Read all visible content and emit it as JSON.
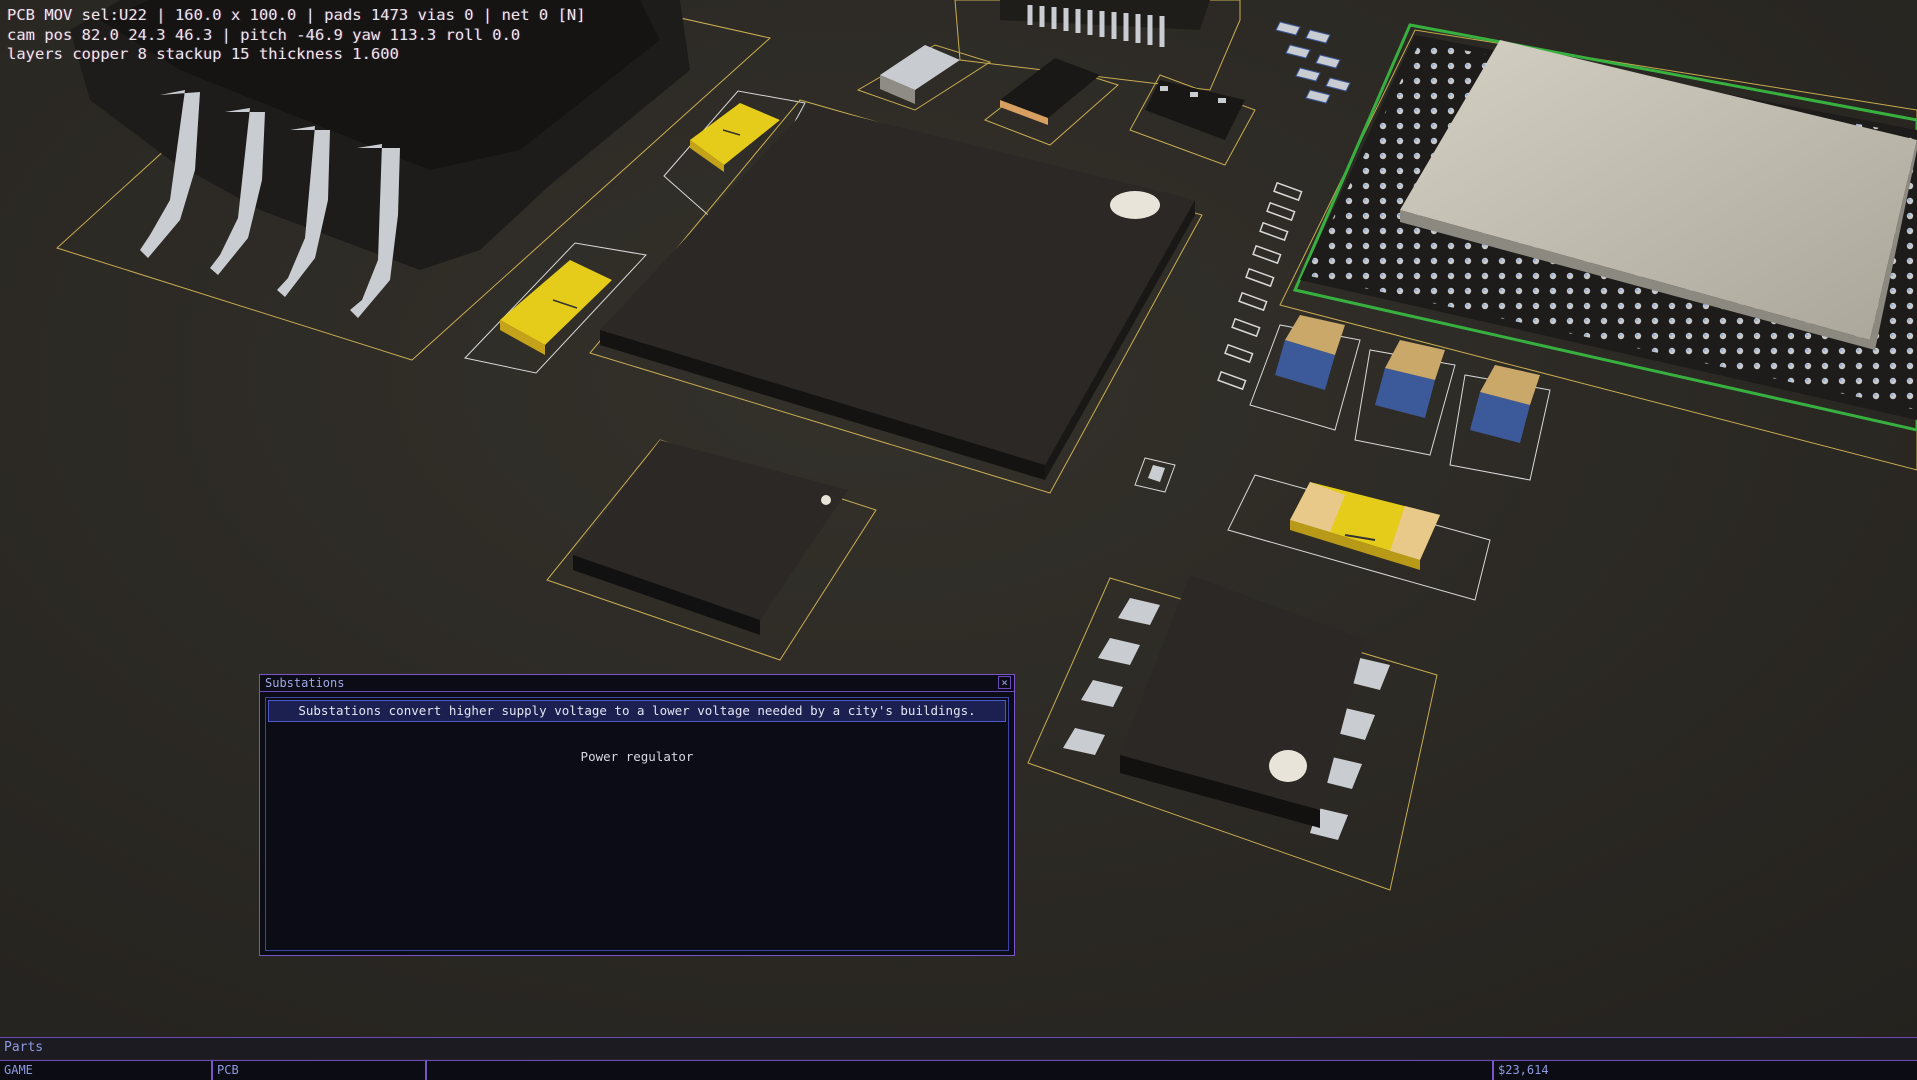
{
  "hud": {
    "line1": "PCB MOV sel:U22 | 160.0 x 100.0 | pads 1473 vias 0 | net 0 [N]",
    "line2": "cam pos 82.0 24.3 46.3 | pitch -46.9 yaw 113.3 roll 0.0",
    "line3": "layers copper 8 stackup 15 thickness 1.600"
  },
  "dialog": {
    "title": "Substations",
    "close_glyph": "×",
    "description": "Substations convert higher supply voltage to a lower voltage needed by a city's buildings.",
    "part_name": "Power regulator"
  },
  "parts_bar": {
    "label": "Parts"
  },
  "status_bar": {
    "mode": "GAME",
    "view": "PCB",
    "money": "$23,614"
  },
  "colors": {
    "board": "#2c2a25",
    "silkscreen_outline": "#c8ac52",
    "ic_body": "#2a2723",
    "pin_metal": "#c8ccd0",
    "led_yellow": "#e6cc1a",
    "ui_border": "#7a55c8",
    "ui_text": "#8d9ae0"
  }
}
